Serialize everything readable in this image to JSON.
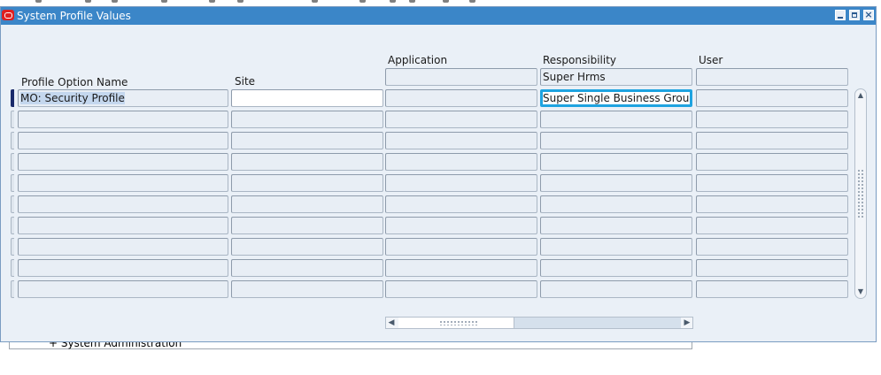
{
  "window": {
    "title": "System Profile Values",
    "controls": [
      "minimize-icon",
      "maximize-icon",
      "close-icon"
    ]
  },
  "background": {
    "tree_item": "+  System Administration"
  },
  "columns": {
    "profile_option_name": "Profile Option Name",
    "site": "Site",
    "application": "Application",
    "responsibility": "Responsibility",
    "user": "User"
  },
  "context": {
    "application": "",
    "responsibility": "Super Hrms",
    "user": ""
  },
  "rows": [
    {
      "profile_option": "MO: Security Profile",
      "site": "",
      "application": "",
      "responsibility": "Super Single Business Group",
      "user": ""
    },
    {
      "profile_option": "",
      "site": "",
      "application": "",
      "responsibility": "",
      "user": ""
    },
    {
      "profile_option": "",
      "site": "",
      "application": "",
      "responsibility": "",
      "user": ""
    },
    {
      "profile_option": "",
      "site": "",
      "application": "",
      "responsibility": "",
      "user": ""
    },
    {
      "profile_option": "",
      "site": "",
      "application": "",
      "responsibility": "",
      "user": ""
    },
    {
      "profile_option": "",
      "site": "",
      "application": "",
      "responsibility": "",
      "user": ""
    },
    {
      "profile_option": "",
      "site": "",
      "application": "",
      "responsibility": "",
      "user": ""
    },
    {
      "profile_option": "",
      "site": "",
      "application": "",
      "responsibility": "",
      "user": ""
    },
    {
      "profile_option": "",
      "site": "",
      "application": "",
      "responsibility": "",
      "user": ""
    },
    {
      "profile_option": "",
      "site": "",
      "application": "",
      "responsibility": "",
      "user": ""
    }
  ],
  "colors": {
    "titlebar": "#3b86c8",
    "window_bg": "#eaf0f7",
    "focus_border": "#1ea3e0",
    "active_row_marker": "#1a2a6a"
  },
  "icons": {
    "logo": "oracle-logo-icon",
    "scroll_up": "arrow-up-icon",
    "scroll_down": "arrow-down-icon",
    "scroll_left": "arrow-left-icon",
    "scroll_right": "arrow-right-icon"
  }
}
